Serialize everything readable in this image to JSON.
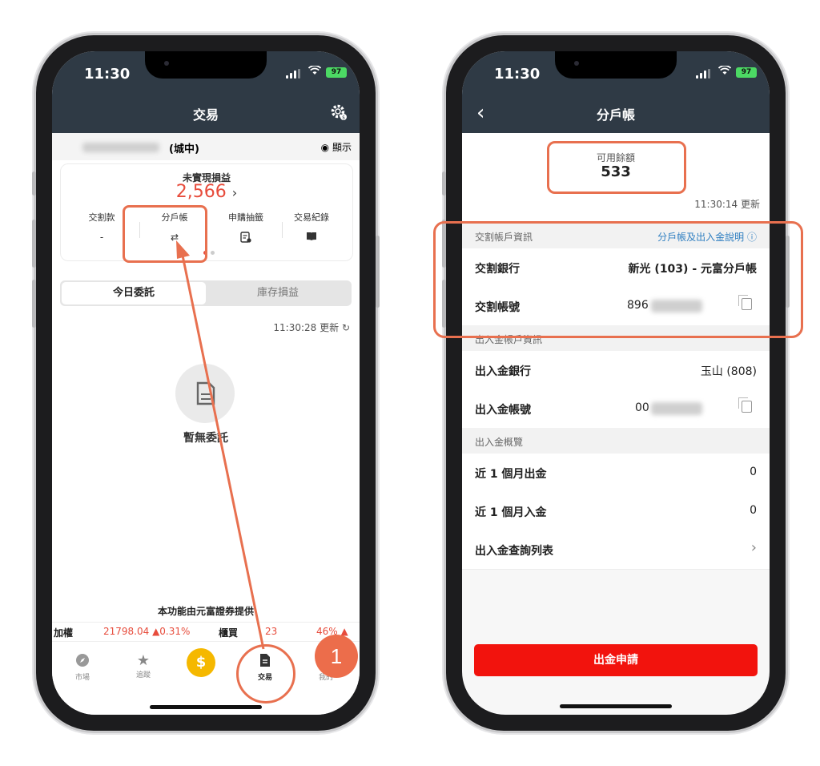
{
  "left": {
    "status": {
      "time": "11:30",
      "battery": "97"
    },
    "nav": {
      "title": "交易"
    },
    "account": {
      "branch": "(城中)",
      "show_label": "顯示"
    },
    "pnl": {
      "label": "未實現損益",
      "value": "2,566",
      "arrow": "›"
    },
    "columns": [
      {
        "label": "交割款",
        "value": "-"
      },
      {
        "label": "分戶帳",
        "value": ""
      },
      {
        "label": "申購抽籤",
        "value": ""
      },
      {
        "label": "交易紀錄",
        "value": ""
      }
    ],
    "tabs": {
      "today": "今日委託",
      "inventory": "庫存損益"
    },
    "updated": "11:30:28 更新",
    "empty": "暫無委託",
    "provider": "本功能由元富證券提供",
    "ticker": {
      "taiex_label": "加權",
      "taiex_value": "21798.04 ▲0.31%",
      "otc_label": "櫃買",
      "otc_value": "23",
      "otc_tail": "46% ▲"
    },
    "tabbar": [
      {
        "label": "市場",
        "icon": "compass-icon"
      },
      {
        "label": "追蹤",
        "icon": "star-icon"
      },
      {
        "label": "",
        "icon": "coin-icon"
      },
      {
        "label": "交易",
        "icon": "document-icon"
      },
      {
        "label": "我的",
        "icon": "person-icon"
      }
    ],
    "callout_number": "1",
    "colors": {
      "accent": "#e74c3c",
      "annotation": "#e8704f",
      "navbar": "#2f3a45"
    }
  },
  "right": {
    "status": {
      "time": "11:30",
      "battery": "97"
    },
    "nav": {
      "title": "分戶帳"
    },
    "balance": {
      "label": "可用餘額",
      "value": "533"
    },
    "updated": "11:30:14 更新",
    "settlement_section": {
      "title": "交割帳戶資訊",
      "link": "分戶帳及出入金說明 ⓘ"
    },
    "settlement_bank": {
      "label": "交割銀行",
      "value": "新光 (103) - 元富分戶帳"
    },
    "settlement_account": {
      "label": "交割帳號",
      "value": "896"
    },
    "deposit_section": {
      "title": "出入金帳戶資訊"
    },
    "deposit_bank": {
      "label": "出入金銀行",
      "value": "玉山 (808)"
    },
    "deposit_account": {
      "label": "出入金帳號",
      "value": "00"
    },
    "overview_section": {
      "title": "出入金概覽"
    },
    "month_out": {
      "label": "近 1 個月出金",
      "value": "0"
    },
    "month_in": {
      "label": "近 1 個月入金",
      "value": "0"
    },
    "query_list": {
      "label": "出入金查詢列表",
      "arrow": "›"
    },
    "withdraw_button": "出金申請",
    "colors": {
      "button": "#f2130d",
      "link": "#2f7fc1"
    }
  }
}
